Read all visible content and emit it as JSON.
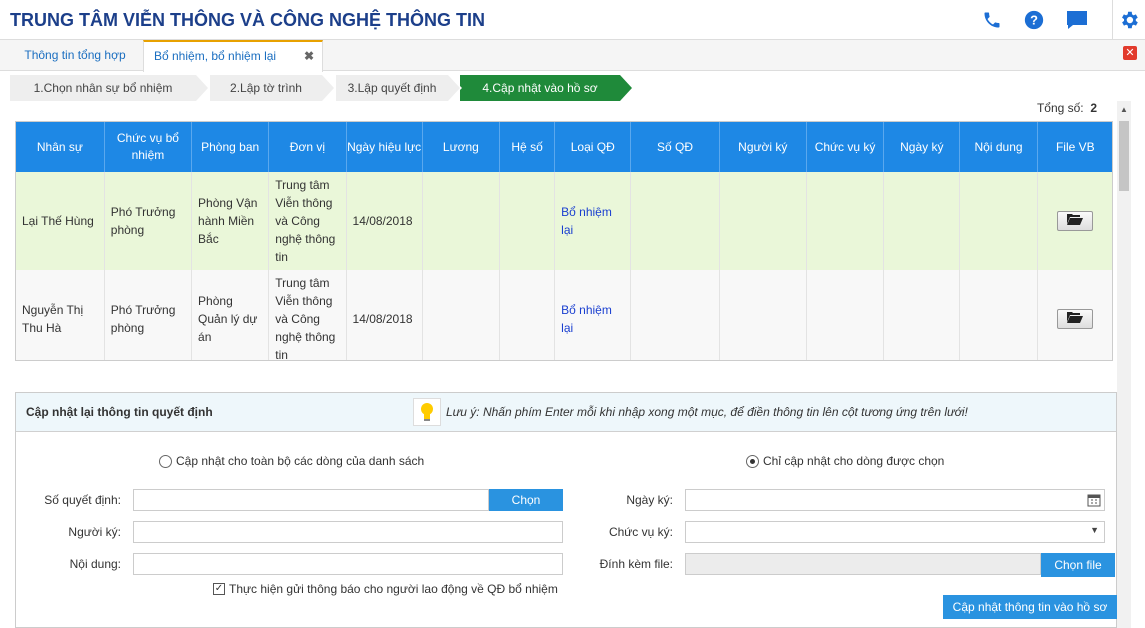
{
  "header": {
    "title": "TRUNG TÂM VIỄN THÔNG VÀ CÔNG NGHỆ THÔNG TIN",
    "accent": "#1c6ed4"
  },
  "tabs": [
    {
      "label": "Thông tin tổng hợp"
    },
    {
      "label": "Bổ nhiệm, bổ nhiệm lại",
      "close": "✖"
    }
  ],
  "steps": [
    {
      "label": "1.Chọn nhân sự bổ nhiệm"
    },
    {
      "label": "2.Lập tờ trình"
    },
    {
      "label": "3.Lập quyết định"
    },
    {
      "label": "4.Cập nhật vào hồ sơ"
    }
  ],
  "grid": {
    "total_label": "Tổng số:",
    "total": "2",
    "columns": [
      "Nhân sự",
      "Chức vụ bổ nhiệm",
      "Phòng ban",
      "Đơn vị",
      "Ngày hiệu lực",
      "Lương",
      "Hệ số",
      "Loại QĐ",
      "Số QĐ",
      "Người ký",
      "Chức vụ ký",
      "Ngày ký",
      "Nội dung",
      "File VB"
    ],
    "rows": [
      {
        "name": "Lại Thế Hùng",
        "position": "Phó Trưởng phòng",
        "dept": "Phòng Vận hành Miền Bắc",
        "unit": "Trung tâm Viễn thông và Công nghệ thông tin",
        "date": "14/08/2018",
        "salary": "",
        "coef": "",
        "type": "Bổ nhiệm lại",
        "no": "",
        "signer": "",
        "signer_pos": "",
        "sign_date": "",
        "content": ""
      },
      {
        "name": "Nguyễn Thị Thu Hà",
        "position": "Phó Trưởng phòng",
        "dept": "Phòng Quản lý dự án",
        "unit": "Trung tâm Viễn thông và Công nghệ thông tin",
        "date": "14/08/2018",
        "salary": "",
        "coef": "",
        "type": "Bổ nhiệm lại",
        "no": "",
        "signer": "",
        "signer_pos": "",
        "sign_date": "",
        "content": ""
      }
    ]
  },
  "panel": {
    "title": "Cập nhật lại thông tin quyết định",
    "note": "Lưu ý: Nhấn phím Enter mỗi khi nhập xong một mục, để điền thông tin lên cột tương ứng trên lưới!",
    "radio_all": "Cập nhật cho toàn bộ các dòng của danh sách",
    "radio_selected": "Chỉ cập nhật cho dòng được chọn",
    "so_qd_label": "Số quyết định:",
    "chon_label": "Chọn",
    "nguoi_ky_label": "Người ký:",
    "noi_dung_label": "Nội dung:",
    "ngay_ky_label": "Ngày ký:",
    "chuc_vu_ky_label": "Chức vụ ký:",
    "dinh_kem_label": "Đính kèm file:",
    "chon_file_label": "Chọn file",
    "notify_label": "Thực hiện gửi thông báo cho người lao động về QĐ bổ nhiệm",
    "submit_label": "Cập nhật thông tin vào hồ sơ"
  }
}
